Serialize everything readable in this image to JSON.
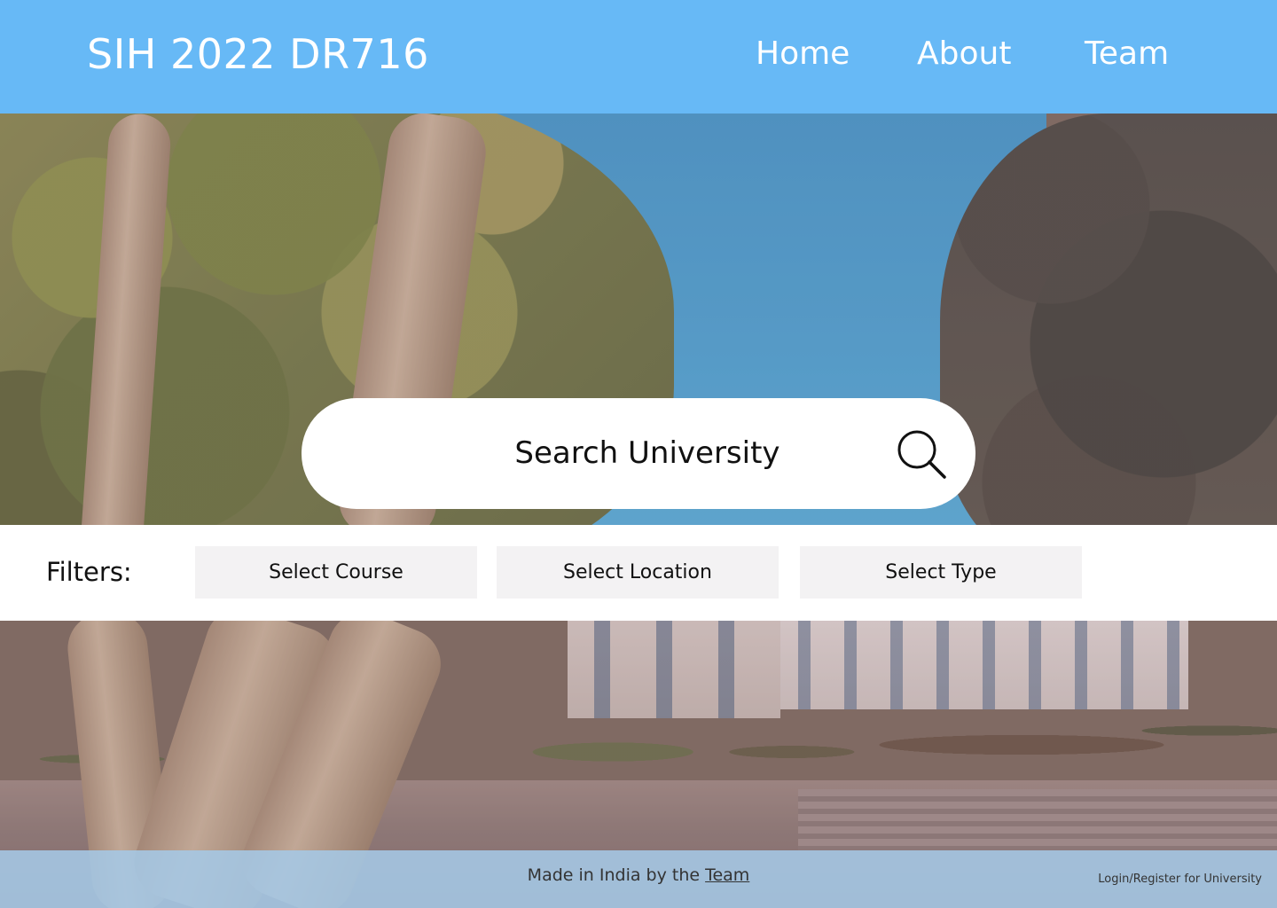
{
  "header": {
    "brand": "SIH 2022 DR716",
    "nav": {
      "home": "Home",
      "about": "About",
      "team": "Team"
    },
    "background_color": "#67b9f6"
  },
  "search": {
    "placeholder": "Search University",
    "icon": "magnifier-icon"
  },
  "filters": {
    "label": "Filters:",
    "course": "Select Course",
    "location": "Select Location",
    "type": "Select Type"
  },
  "footer": {
    "made_in": "Made in India by the ",
    "team_link": "Team",
    "login": "Login/Register for University"
  }
}
